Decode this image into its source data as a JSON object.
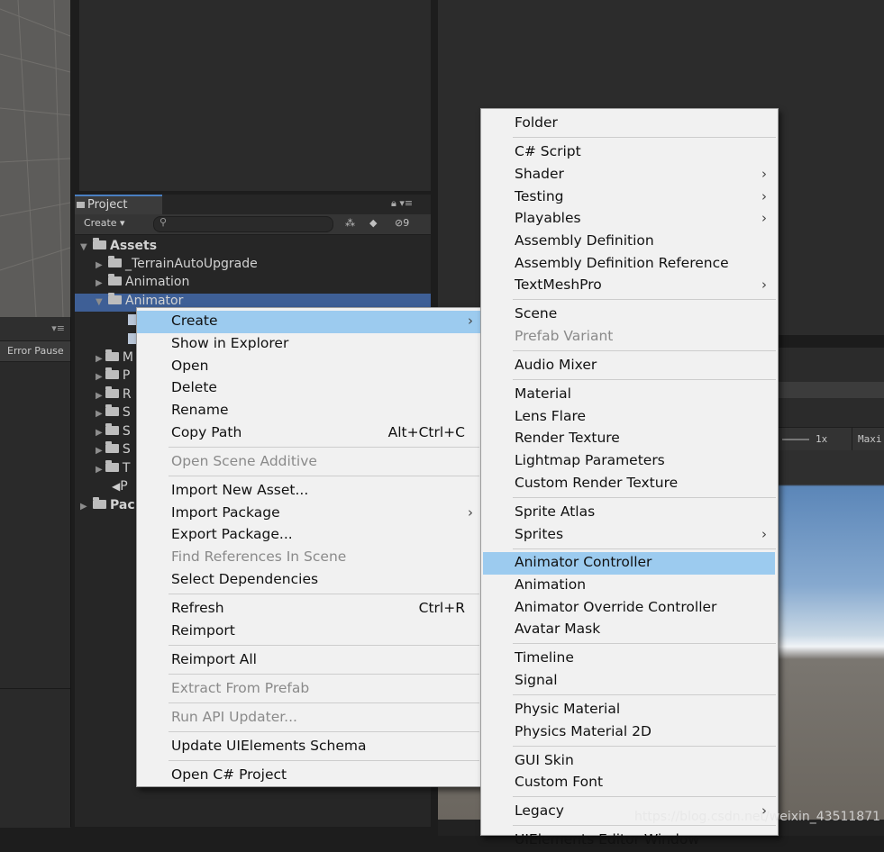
{
  "project_panel": {
    "tab_label": "Project",
    "create_label": "Create ▾",
    "hidden_count": "9",
    "tree": {
      "assets_label": "Assets",
      "terrain_label": "_TerrainAutoUpgrade",
      "animation_label": "Animation",
      "animator_label": "Animator",
      "packages_label": "Pac",
      "partial_labels": [
        "M",
        "P",
        "R",
        "S",
        "S",
        "S",
        "T",
        "P"
      ]
    }
  },
  "console_panel": {
    "error_pause_label": "Error Pause"
  },
  "game_view": {
    "scale_label": "1x",
    "maximize_label": "Maxi"
  },
  "context_menu": {
    "items": [
      {
        "label": "Create",
        "submenu": true,
        "highlight": true
      },
      {
        "label": "Show in Explorer"
      },
      {
        "label": "Open"
      },
      {
        "label": "Delete"
      },
      {
        "label": "Rename"
      },
      {
        "label": "Copy Path",
        "shortcut": "Alt+Ctrl+C"
      },
      {
        "label": "Open Scene Additive",
        "disabled": true
      },
      {
        "label": "Import New Asset..."
      },
      {
        "label": "Import Package",
        "submenu": true
      },
      {
        "label": "Export Package..."
      },
      {
        "label": "Find References In Scene",
        "disabled": true
      },
      {
        "label": "Select Dependencies"
      },
      {
        "label": "Refresh",
        "shortcut": "Ctrl+R"
      },
      {
        "label": "Reimport"
      },
      {
        "label": "Reimport All"
      },
      {
        "label": "Extract From Prefab",
        "disabled": true
      },
      {
        "label": "Run API Updater...",
        "disabled": true
      },
      {
        "label": "Update UIElements Schema"
      },
      {
        "label": "Open C# Project"
      }
    ]
  },
  "create_submenu": {
    "items": [
      {
        "label": "Folder"
      },
      {
        "label": "C# Script"
      },
      {
        "label": "Shader",
        "submenu": true
      },
      {
        "label": "Testing",
        "submenu": true
      },
      {
        "label": "Playables",
        "submenu": true
      },
      {
        "label": "Assembly Definition"
      },
      {
        "label": "Assembly Definition Reference"
      },
      {
        "label": "TextMeshPro",
        "submenu": true
      },
      {
        "label": "Scene"
      },
      {
        "label": "Prefab Variant",
        "disabled": true
      },
      {
        "label": "Audio Mixer"
      },
      {
        "label": "Material"
      },
      {
        "label": "Lens Flare"
      },
      {
        "label": "Render Texture"
      },
      {
        "label": "Lightmap Parameters"
      },
      {
        "label": "Custom Render Texture"
      },
      {
        "label": "Sprite Atlas"
      },
      {
        "label": "Sprites",
        "submenu": true
      },
      {
        "label": "Animator Controller",
        "highlight": true
      },
      {
        "label": "Animation"
      },
      {
        "label": "Animator Override Controller"
      },
      {
        "label": "Avatar Mask"
      },
      {
        "label": "Timeline"
      },
      {
        "label": "Signal"
      },
      {
        "label": "Physic Material"
      },
      {
        "label": "Physics Material 2D"
      },
      {
        "label": "GUI Skin"
      },
      {
        "label": "Custom Font"
      },
      {
        "label": "Legacy",
        "submenu": true
      },
      {
        "label": "UIElements Editor Window"
      }
    ]
  },
  "watermark": "https://blog.csdn.net/weixin_43511871"
}
